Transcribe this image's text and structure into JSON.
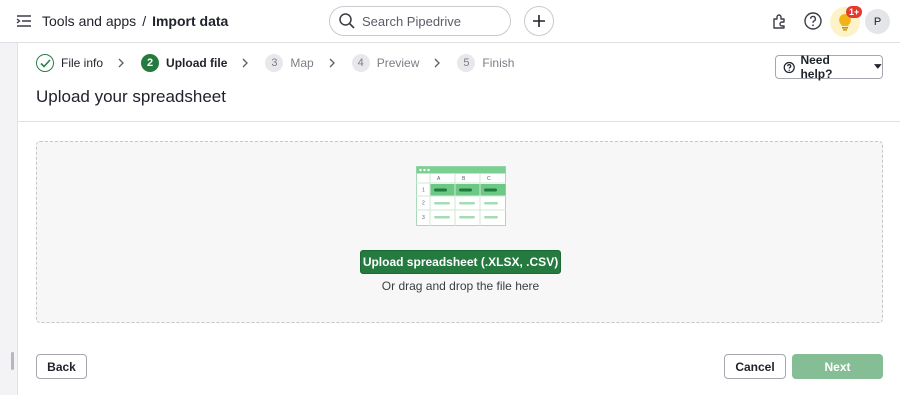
{
  "header": {
    "menu_icon": "menu-collapse-icon",
    "breadcrumb_parent": "Tools and apps",
    "breadcrumb_separator": "/",
    "breadcrumb_current": "Import data",
    "search_placeholder": "Search Pipedrive",
    "badge_count": "1+",
    "avatar_initial": "P"
  },
  "steps": [
    {
      "number": "",
      "label": "File info",
      "state": "done"
    },
    {
      "number": "2",
      "label": "Upload file",
      "state": "active"
    },
    {
      "number": "3",
      "label": "Map",
      "state": "todo"
    },
    {
      "number": "4",
      "label": "Preview",
      "state": "todo"
    },
    {
      "number": "5",
      "label": "Finish",
      "state": "todo"
    }
  ],
  "page": {
    "title": "Upload your spreadsheet",
    "need_help_label": "Need help?"
  },
  "dropzone": {
    "illustration": {
      "columns": [
        "A",
        "B",
        "C"
      ],
      "rows": [
        "1",
        "2",
        "3"
      ]
    },
    "upload_button_label": "Upload spreadsheet (.XLSX, .CSV)",
    "drag_drop_text": "Or drag and drop the file here"
  },
  "footer": {
    "back_label": "Back",
    "cancel_label": "Cancel",
    "next_label": "Next"
  },
  "colors": {
    "primary_green": "#257a40",
    "disabled_green": "#85bd94",
    "badge_red": "#e43a2e"
  }
}
